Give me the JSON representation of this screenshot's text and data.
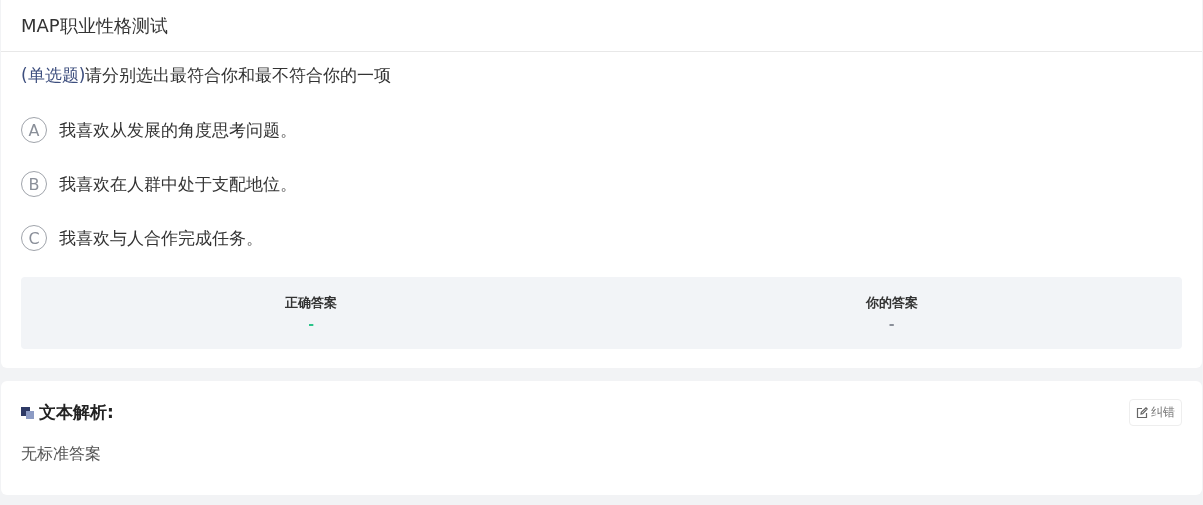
{
  "header": {
    "title": "MAP职业性格测试"
  },
  "question": {
    "type_label": "(单选题)",
    "text": "请分别选出最符合你和最不符合你的一项"
  },
  "options": [
    {
      "letter": "A",
      "text": "我喜欢从发展的角度思考问题。",
      "selected": false
    },
    {
      "letter": "B",
      "text": "我喜欢在人群中处于支配地位。",
      "selected": false
    },
    {
      "letter": "C",
      "text": "我喜欢与人合作完成任务。",
      "selected": false
    }
  ],
  "answers": [
    {
      "label": "正确答案",
      "value": "-",
      "color": "#2bc48a"
    },
    {
      "label": "你的答案",
      "value": "-",
      "color": "#8a8f99"
    }
  ],
  "analysis": {
    "title": "文本解析:",
    "correct_button": "纠错",
    "text": "无标准答案"
  }
}
